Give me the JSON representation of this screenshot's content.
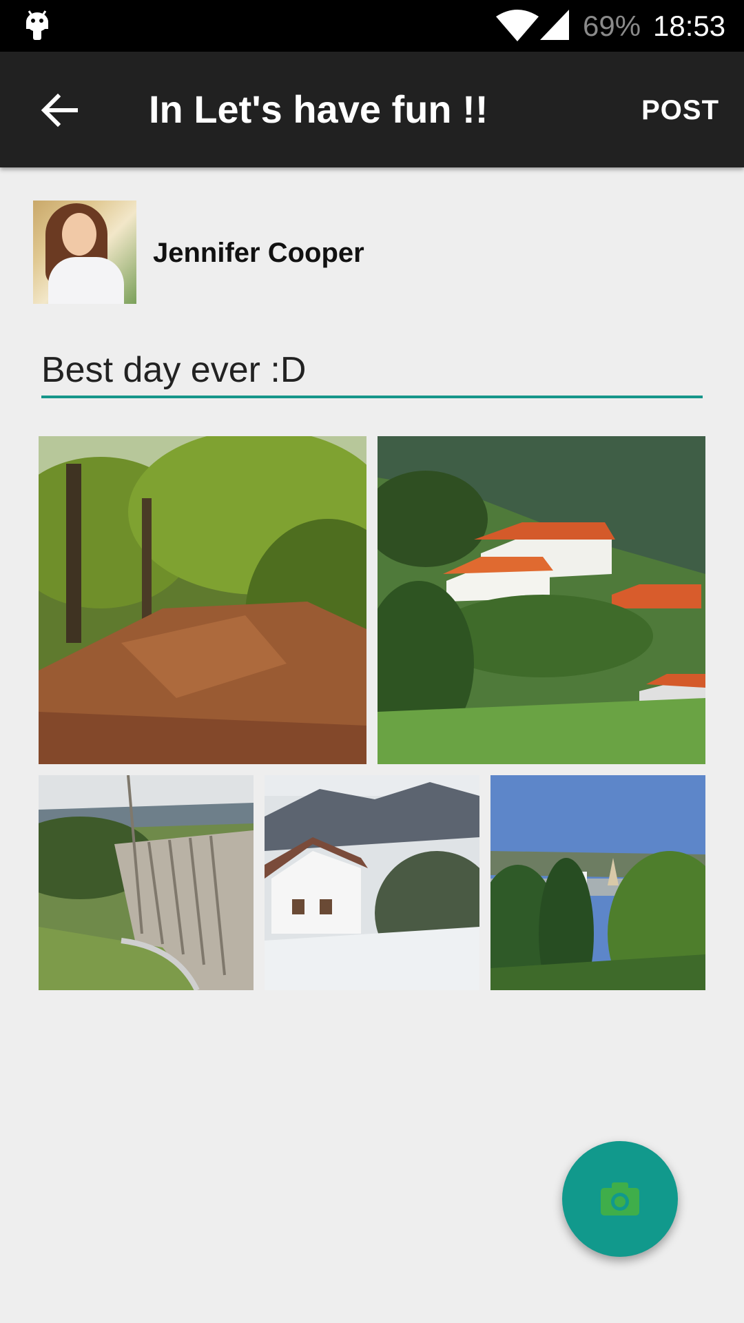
{
  "status_bar": {
    "battery": "69%",
    "time": "18:53",
    "icons": [
      "android-icon",
      "wifi-icon",
      "signal-icon"
    ]
  },
  "toolbar": {
    "title": "In Let's have fun !!",
    "post_label": "POST",
    "back_icon": "arrow-back-icon"
  },
  "author": {
    "name": "Jennifer Cooper"
  },
  "composer": {
    "text": "Best day ever :D"
  },
  "photos": [
    {
      "subject": "forest path with fallen leaves"
    },
    {
      "subject": "white houses with orange roofs on green hillside"
    },
    {
      "subject": "dam in the hills"
    },
    {
      "subject": "snowy village with white house"
    },
    {
      "subject": "town with trees and tower under blue sky"
    }
  ],
  "fab": {
    "icon": "camera-icon"
  },
  "colors": {
    "accent": "#11998c",
    "underline": "#16968a",
    "toolbar_bg": "#212121",
    "fab_icon": "#3fae4a"
  }
}
